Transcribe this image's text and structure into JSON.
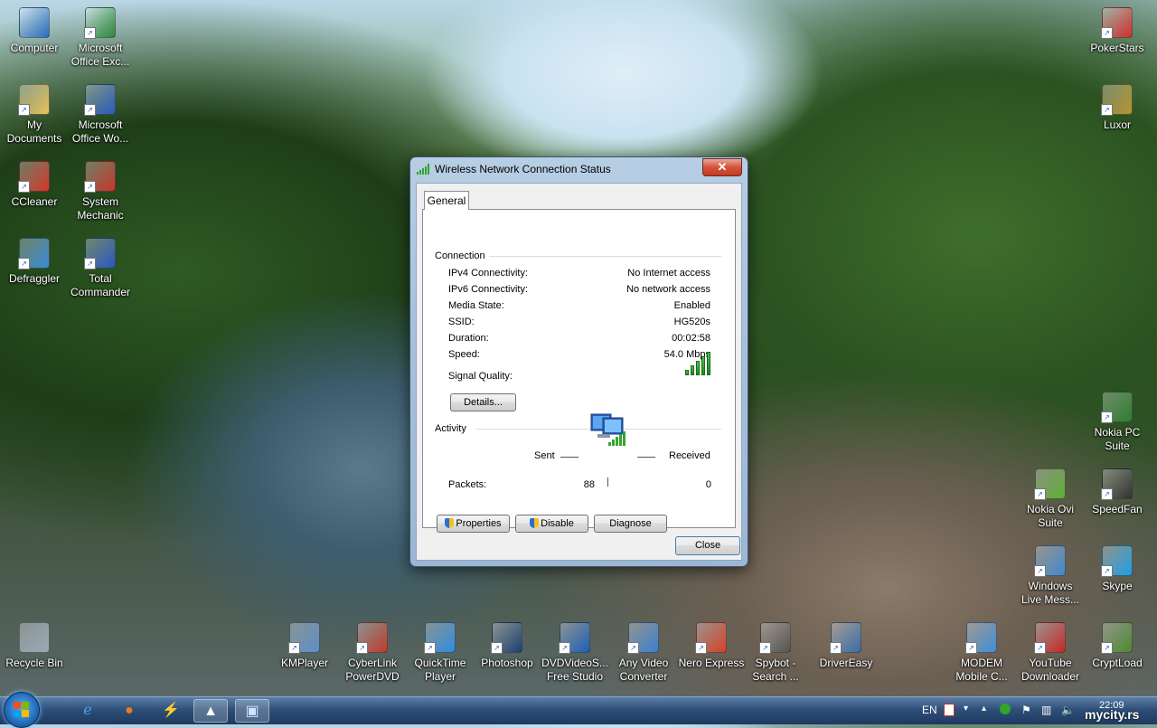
{
  "desktop": {
    "left_icons": [
      {
        "label1": "Computer",
        "label2": "",
        "icon": "computer-icon",
        "color": "#2b6fbf"
      },
      {
        "label1": "Microsoft",
        "label2": "Office Exc...",
        "icon": "excel-icon",
        "color": "#2b8a3e"
      },
      {
        "label1": "My",
        "label2": "Documents",
        "icon": "folder-icon",
        "color": "#e8c45a"
      },
      {
        "label1": "Microsoft",
        "label2": "Office Wo...",
        "icon": "word-icon",
        "color": "#2b5fbf"
      },
      {
        "label1": "CCleaner",
        "label2": "",
        "icon": "ccleaner-icon",
        "color": "#d9362b"
      },
      {
        "label1": "System",
        "label2": "Mechanic",
        "icon": "toolbox-icon",
        "color": "#c9342a"
      },
      {
        "label1": "Defraggler",
        "label2": "",
        "icon": "defraggler-icon",
        "color": "#3a8ad6"
      },
      {
        "label1": "Total",
        "label2": "Commander",
        "icon": "floppy-icon",
        "color": "#2b56c4"
      },
      {
        "label1": "Recycle Bin",
        "label2": "",
        "icon": "recycle-bin-icon",
        "color": "#9aa9b8"
      }
    ],
    "bottom_icons": [
      {
        "label1": "KMPlayer",
        "label2": "",
        "icon": "kmplayer-icon",
        "color": "#5a8fc8"
      },
      {
        "label1": "CyberLink",
        "label2": "PowerDVD",
        "icon": "powerdvd-icon",
        "color": "#c0392b"
      },
      {
        "label1": "QuickTime",
        "label2": "Player",
        "icon": "quicktime-icon",
        "color": "#2f8be0"
      },
      {
        "label1": "Photoshop",
        "label2": "",
        "icon": "photoshop-icon",
        "color": "#1e3f73"
      },
      {
        "label1": "DVDVideoS...",
        "label2": "Free Studio",
        "icon": "dvdvideosoft-icon",
        "color": "#1d5fb8"
      },
      {
        "label1": "Any Video",
        "label2": "Converter",
        "icon": "video-converter-icon",
        "color": "#3c7fd0"
      },
      {
        "label1": "Nero Express",
        "label2": "",
        "icon": "nero-icon",
        "color": "#d8402a"
      },
      {
        "label1": "Spybot -",
        "label2": "Search ...",
        "icon": "spybot-icon",
        "color": "#555555"
      },
      {
        "label1": "DriverEasy",
        "label2": "",
        "icon": "drivereasy-icon",
        "color": "#3a6ea5"
      },
      {
        "label1": "MODEM",
        "label2": "Mobile C...",
        "icon": "modem-icon",
        "color": "#3f8fd8"
      },
      {
        "label1": "YouTube",
        "label2": "Downloader",
        "icon": "youtube-downloader-icon",
        "color": "#c62828"
      },
      {
        "label1": "CryptLoad",
        "label2": "",
        "icon": "cryptload-icon",
        "color": "#4c8a2e"
      }
    ],
    "right_icons": [
      {
        "label1": "PokerStars",
        "label2": "",
        "icon": "pokerstars-icon",
        "color": "#d32f2f"
      },
      {
        "label1": "Luxor",
        "label2": "",
        "icon": "luxor-icon",
        "color": "#b8932e"
      },
      {
        "label1": "Nokia PC",
        "label2": "Suite",
        "icon": "nokia-pc-suite-icon",
        "color": "#2e7d32"
      },
      {
        "label1": "Nokia Ovi",
        "label2": "Suite",
        "icon": "ovi-icon",
        "color": "#5fb035"
      },
      {
        "label1": "SpeedFan",
        "label2": "",
        "icon": "speedfan-icon",
        "color": "#333333"
      },
      {
        "label1": "Windows",
        "label2": "Live Mess...",
        "icon": "messenger-icon",
        "color": "#3f8ad0"
      },
      {
        "label1": "Skype",
        "label2": "",
        "icon": "skype-icon",
        "color": "#1ea0e6"
      }
    ]
  },
  "dialog": {
    "title": "Wireless Network Connection Status",
    "close_glyph": "✕",
    "tab": "General",
    "connection": {
      "heading": "Connection",
      "rows": [
        {
          "key": "IPv4 Connectivity:",
          "value": "No Internet access"
        },
        {
          "key": "IPv6 Connectivity:",
          "value": "No network access"
        },
        {
          "key": "Media State:",
          "value": "Enabled"
        },
        {
          "key": "SSID:",
          "value": "HG520s"
        },
        {
          "key": "Duration:",
          "value": "00:02:58"
        },
        {
          "key": "Speed:",
          "value": "54.0 Mbps"
        }
      ],
      "signal_label": "Signal Quality:",
      "signal_bars": 5,
      "details_button": "Details..."
    },
    "activity": {
      "heading": "Activity",
      "sent_label": "Sent",
      "received_label": "Received",
      "packets_label": "Packets:",
      "packets_sent": "88",
      "packets_received": "0"
    },
    "buttons": {
      "properties": "Properties",
      "disable": "Disable",
      "diagnose": "Diagnose",
      "close": "Close"
    }
  },
  "taskbar": {
    "items": [
      "ie-icon",
      "firefox-icon",
      "winamp-icon",
      "wallpaper-app-icon",
      "network-status-icon"
    ],
    "tray": {
      "language": "EN",
      "clock": "22:09",
      "watermark": "mycity.rs"
    }
  },
  "colors": {
    "accent": "#2fa62a",
    "titlebar": "#b7cee4",
    "close": "#c9432b"
  }
}
